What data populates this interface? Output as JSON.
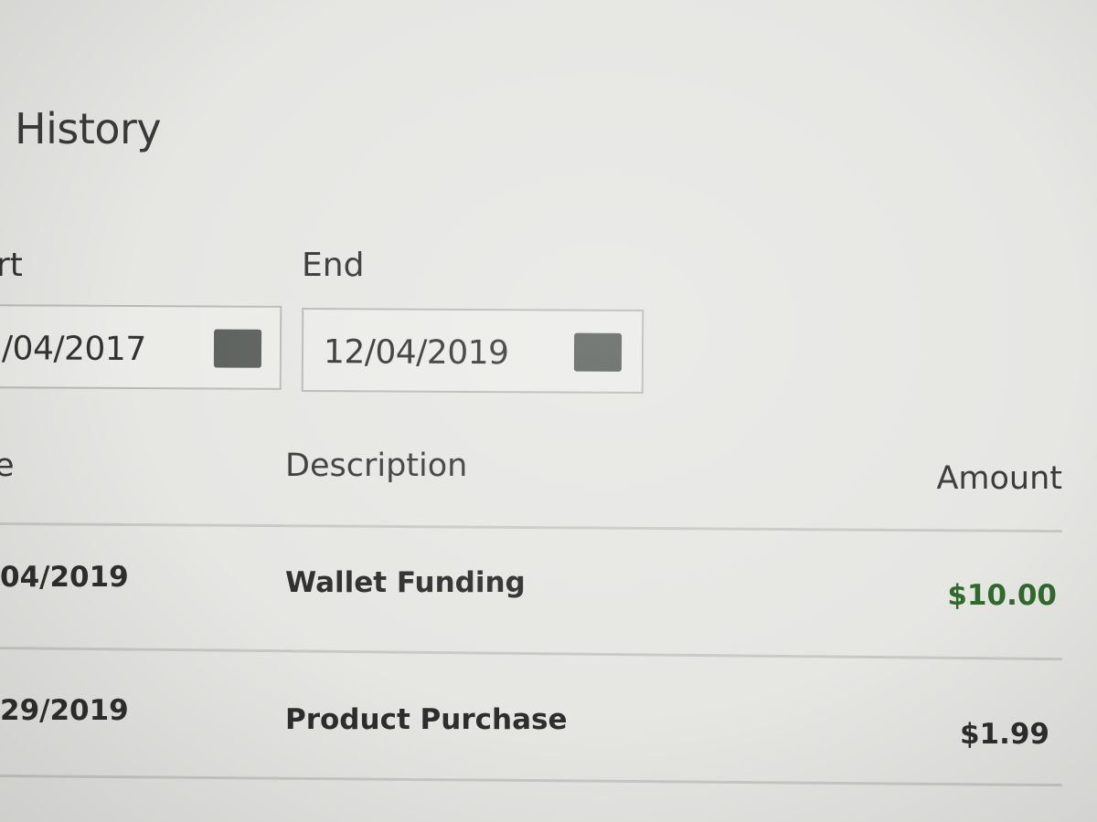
{
  "page": {
    "title": "History"
  },
  "filters": {
    "start": {
      "label": "rt",
      "value": "/04/2017",
      "icon": "calendar-icon"
    },
    "end": {
      "label": "End",
      "value": "12/04/2019",
      "icon": "calendar-icon"
    }
  },
  "table": {
    "columns": {
      "date": "e",
      "description": "Description",
      "amount": "Amount"
    },
    "rows": [
      {
        "date": "04/2019",
        "description": "Wallet Funding",
        "amount": "$10.00",
        "amount_color": "#2f6b2a"
      },
      {
        "date": "29/2019",
        "description": "Product Purchase",
        "amount": "$1.99",
        "amount_color": "#2e2e2e"
      }
    ]
  }
}
